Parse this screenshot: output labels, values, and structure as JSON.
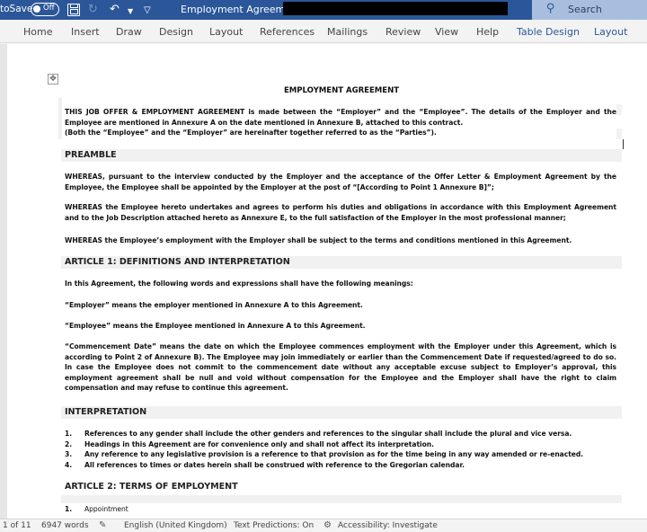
{
  "titlebar": {
    "autosave_label": "toSave",
    "autosave_state": "Off",
    "document_title": "Employment Agreement I",
    "search_placeholder": "Search",
    "icons": {
      "save": "save-icon",
      "redo": "redo-icon",
      "undo": "undo-icon",
      "undo_dropdown": "chevron-down-icon",
      "customize": "customize-qat-icon",
      "search": "search-icon"
    }
  },
  "ribbon": {
    "tabs": [
      {
        "label": "Home",
        "contextual": false
      },
      {
        "label": "Insert",
        "contextual": false
      },
      {
        "label": "Draw",
        "contextual": false
      },
      {
        "label": "Design",
        "contextual": false
      },
      {
        "label": "Layout",
        "contextual": false
      },
      {
        "label": "References",
        "contextual": false
      },
      {
        "label": "Mailings",
        "contextual": false
      },
      {
        "label": "Review",
        "contextual": false
      },
      {
        "label": "View",
        "contextual": false
      },
      {
        "label": "Help",
        "contextual": false
      },
      {
        "label": "Table Design",
        "contextual": true
      },
      {
        "label": "Layout",
        "contextual": true
      }
    ]
  },
  "document": {
    "title": "EMPLOYMENT AGREEMENT",
    "intro": [
      "THIS JOB OFFER & EMPLOYMENT AGREEMENT is made between the “Employer” and the “Employee”. The details of the Employer and the Employee are mentioned in Annexure A on the date mentioned in Annexure B, attached to this contract.",
      "(Both the “Employee” and the “Employer” are hereinafter together referred to as the “Parties”)."
    ],
    "preamble": {
      "heading": "PREAMBLE",
      "paragraphs": [
        "WHEREAS, pursuant to the interview conducted by the Employer and the acceptance of the Offer Letter & Employment Agreement by the Employee, the Employee shall be appointed by the Employer at the post of “[According to Point 1 Annexure B]”;",
        "WHEREAS the Employee hereto undertakes and agrees to perform his duties and obligations in accordance with this Employment Agreement and to the Job Description attached hereto as Annexure E, to the full satisfaction of the Employer in the most professional manner;",
        "WHEREAS the Employee’s employment with the Employer shall be subject to the terms and conditions mentioned in this Agreement."
      ]
    },
    "article1": {
      "heading": "ARTICLE 1: DEFINITIONS AND INTERPRETATION",
      "paragraphs": [
        "In this Agreement, the following words and expressions shall have the following meanings:",
        "“Employer” means the employer mentioned in Annexure A to this Agreement.",
        "“Employee” means the Employee mentioned in Annexure A to this Agreement.",
        "“Commencement Date” means the date on which the Employee commences employment with the Employer under this Agreement, which is according to Point 2 of Annexure B). The Employee may join immediately or earlier than the Commencement Date if requested/agreed to do so. In case the Employee does not commit to the commencement date without any acceptable excuse subject to Employer’s approval, this employment agreement shall be null and void without compensation for the Employee and the Employer shall have the right to claim compensation and may refuse to continue this agreement."
      ]
    },
    "interpretation": {
      "heading": "INTERPRETATION",
      "items": [
        {
          "num": "1.",
          "text": "References to any gender shall include the other genders and references to the singular shall include the plural and vice versa."
        },
        {
          "num": "2.",
          "text": "Headings in this Agreement are for convenience only and shall not affect its interpretation."
        },
        {
          "num": "3.",
          "text": "Any reference to any legislative provision is a reference to that provision as for the time being in any way amended or re-enacted."
        },
        {
          "num": "4.",
          "text": "All references to times or dates herein shall be construed with reference to the Gregorian calendar."
        }
      ]
    },
    "article2": {
      "heading": "ARTICLE 2: TERMS OF EMPLOYMENT",
      "items": [
        {
          "num": "1.",
          "text": "Appointment"
        }
      ]
    }
  },
  "statusbar": {
    "page": "1 of 11",
    "words": "6947 words",
    "language": "English (United Kingdom)",
    "text_predictions": "Text Predictions: On",
    "accessibility": "Accessibility: Investigate"
  }
}
